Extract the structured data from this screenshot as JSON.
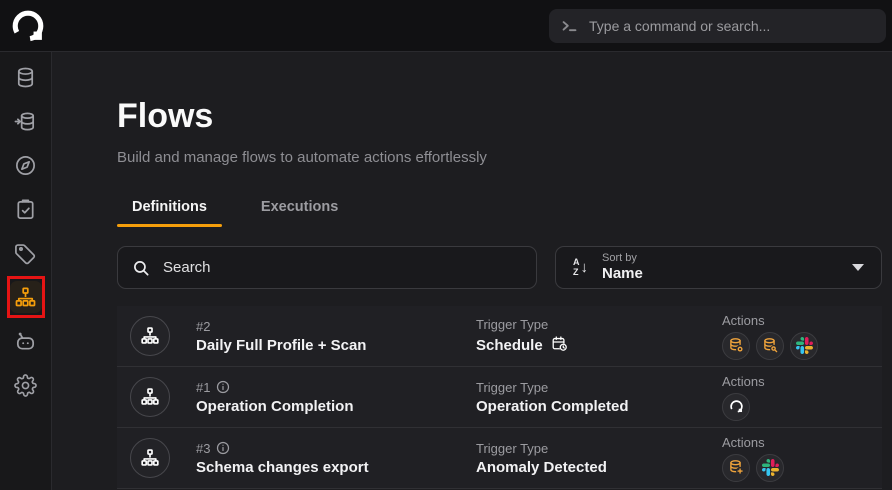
{
  "topbar": {
    "logo": "Q",
    "command_placeholder": "Type a command or search..."
  },
  "sidebar": {
    "items": [
      {
        "icon": "database-icon",
        "active": false
      },
      {
        "icon": "database-import-icon",
        "active": false
      },
      {
        "icon": "compass-icon",
        "active": false
      },
      {
        "icon": "clipboard-check-icon",
        "active": false
      },
      {
        "icon": "tag-icon",
        "active": false
      },
      {
        "icon": "flows-icon",
        "active": true,
        "annotated_red_box": true
      },
      {
        "icon": "bot-icon",
        "active": false
      },
      {
        "icon": "settings-icon",
        "active": false
      }
    ]
  },
  "page": {
    "title": "Flows",
    "subtitle": "Build and manage flows to automate actions effortlessly"
  },
  "tabs": [
    {
      "label": "Definitions",
      "active": true
    },
    {
      "label": "Executions",
      "active": false
    }
  ],
  "toolbar": {
    "search_placeholder": "Search",
    "sort_by_label": "Sort by",
    "sort_value": "Name"
  },
  "list": {
    "trigger_type_label": "Trigger Type",
    "actions_label": "Actions",
    "rows": [
      {
        "number": "#2",
        "has_info": false,
        "name": "Daily Full Profile + Scan",
        "trigger": "Schedule",
        "trigger_icon": "calendar-clock-icon",
        "actions": [
          "database-profile-icon",
          "database-scan-icon",
          "slack-icon"
        ]
      },
      {
        "number": "#1",
        "has_info": true,
        "name": "Operation Completion",
        "trigger": "Operation Completed",
        "trigger_icon": null,
        "actions": [
          "q-logo-icon"
        ]
      },
      {
        "number": "#3",
        "has_info": true,
        "name": "Schema changes export",
        "trigger": "Anomaly Detected",
        "trigger_icon": null,
        "actions": [
          "database-add-icon",
          "slack-icon"
        ]
      }
    ]
  },
  "colors": {
    "accent": "#f59e0b",
    "annotation_red": "#e51414",
    "action_orange": "#f0a43c",
    "slack_blue": "#36C5F0",
    "slack_green": "#2EB67D",
    "slack_red": "#E01E5A",
    "slack_yellow": "#ECB22E"
  }
}
